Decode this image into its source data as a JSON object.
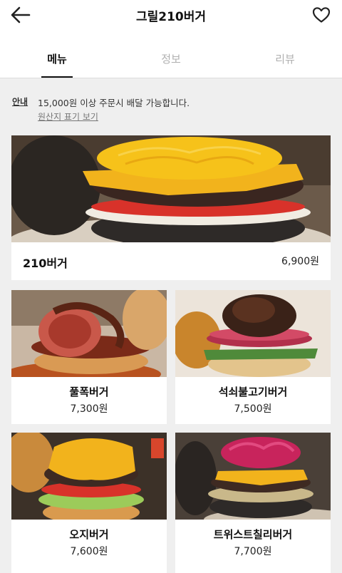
{
  "header": {
    "title": "그릴210버거",
    "back_icon": "arrow-left-icon",
    "favorite_icon": "heart-outline-icon"
  },
  "tabs": [
    {
      "label": "메뉴",
      "active": true
    },
    {
      "label": "정보",
      "active": false
    },
    {
      "label": "리뷰",
      "active": false
    }
  ],
  "notice": {
    "label": "안내",
    "text": "15,000원 이상 주문시 배달 가능합니다.",
    "link": "원산지 표기 보기"
  },
  "menu": [
    {
      "name": "210버거",
      "price": "6,900원"
    },
    {
      "name": "풀폭버거",
      "price": "7,300원"
    },
    {
      "name": "석쇠불고기버거",
      "price": "7,500원"
    },
    {
      "name": "오지버거",
      "price": "7,600원"
    },
    {
      "name": "트위스트칠리버거",
      "price": "7,700원"
    }
  ],
  "colors": {
    "background": "#efefef",
    "card": "#ffffff",
    "active_tab": "#111111",
    "inactive_tab": "#b0b0b0",
    "cheese": "#f2b31c",
    "tomato": "#d8322a"
  }
}
